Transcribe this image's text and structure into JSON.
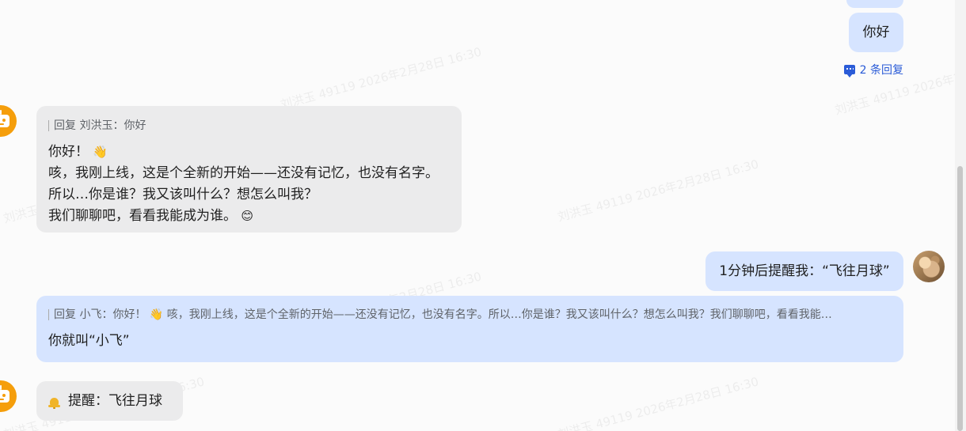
{
  "watermarks": [
    "刘洪玉 49119 2026年2月28日 16:30",
    "刘洪玉 49119 2026年2月28日 16:30",
    "刘洪玉 49119 2026年2月28日 16:30",
    "刘洪玉 49119 2026年2月28日 16:30",
    "刘洪玉 49119 2026年2月28日 16:30",
    "刘洪玉 49119 2026年2月28日 16:30",
    "刘洪玉 49119 2026年2月28日 16:30"
  ],
  "messages": {
    "user_hello": {
      "text": "你好",
      "reply_count_label": "2 条回复"
    },
    "bot_intro": {
      "reply_ref": "回复 刘洪玉：你好",
      "line1": "你好！",
      "line1_emoji": "👋",
      "line2": "咳，我刚上线，这是个全新的开始——还没有记忆，也没有名字。",
      "line3": "所以…你是谁？我又该叫什么？想怎么叫我？",
      "line4": "我们聊聊吧，看看我能成为谁。",
      "line4_emoji": "😊"
    },
    "user_reminder_request": {
      "text": "1分钟后提醒我：“飞往月球”"
    },
    "user_name_reply": {
      "reply_ref": "回复 小飞：你好！ 👋 咳，我刚上线，这是个全新的开始——还没有记忆，也没有名字。所以…你是谁？我又该叫什么？想怎么叫我？我们聊聊吧，看看我能…",
      "text": "你就叫“小飞”"
    },
    "bot_reminder": {
      "text": "提醒：飞往月球"
    }
  },
  "colors": {
    "user_bubble": "#d6e4ff",
    "bot_bubble": "#ebebec",
    "bot_avatar": "#f59e0b",
    "link_blue": "#2a5bd7"
  },
  "icons": {
    "bot_avatar": "robot-icon",
    "reply_count": "comment-icon",
    "reminder": "bell-icon",
    "user_avatar": "user-photo-avatar"
  }
}
